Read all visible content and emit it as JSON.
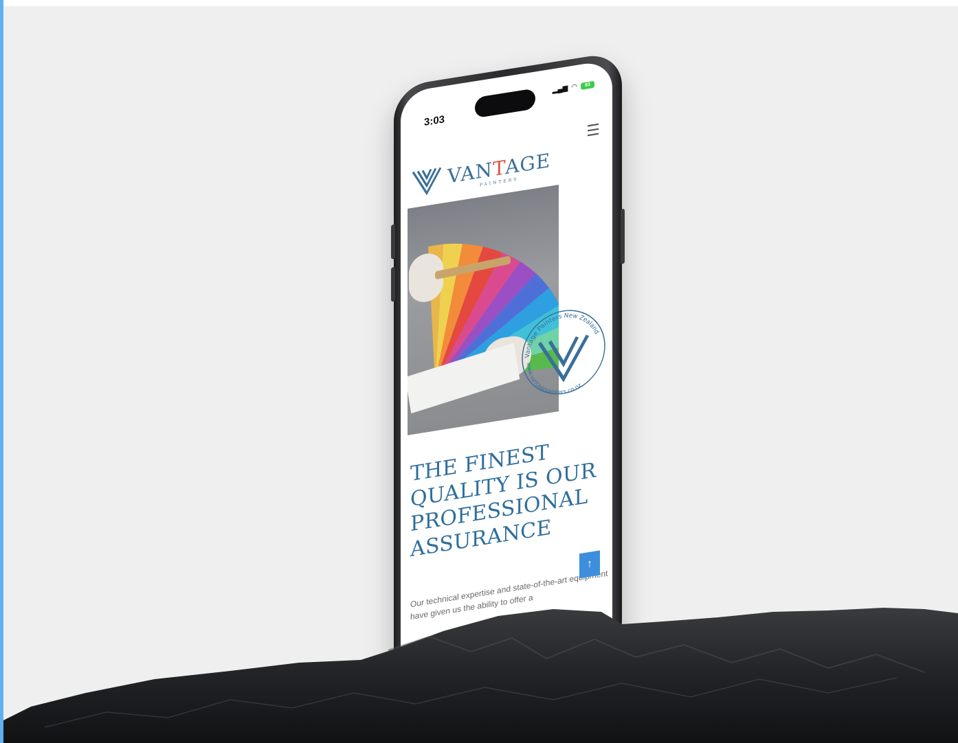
{
  "status_bar": {
    "time": "3:03",
    "signal_icon": "cellular-signal-icon",
    "wifi_icon": "wifi-icon",
    "battery_label": "83"
  },
  "header": {
    "menu_icon": "hamburger-menu-icon",
    "menu_glyph": "☰",
    "brand_prefix": "VAN",
    "brand_accent": "T",
    "brand_suffix": "AGE",
    "brand_sub": "PAINTERS"
  },
  "stamp": {
    "top_text": "Vantage Painters New Zealand",
    "bottom_text": "www.vantagepainters.co.nz"
  },
  "hero": {
    "headline": "THE FINEST QUALITY IS OUR PROFESSIONAL ASSURANCE",
    "body": "Our technical expertise and state-of-the-art equipment have given us the ability to offer a"
  },
  "back_to_top": {
    "glyph": "↑",
    "icon": "arrow-up-icon"
  },
  "footer": {
    "url": "vantagepainters.co.nz"
  },
  "colors": {
    "brand_blue": "#3a6f99",
    "accent_red": "#e05040",
    "button_blue": "#3d8fde",
    "backdrop": "#efefef"
  }
}
